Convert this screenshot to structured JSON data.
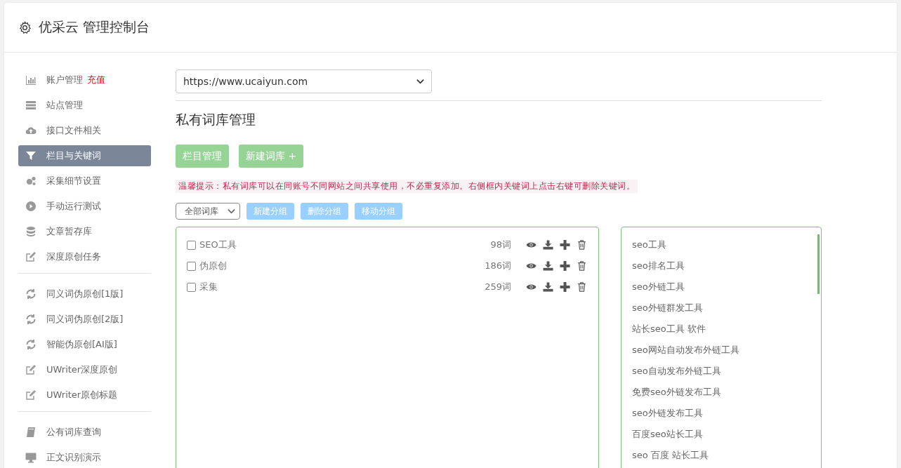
{
  "header": {
    "title": "优采云 管理控制台"
  },
  "sidebar": {
    "groups": [
      [
        {
          "label": "账户管理",
          "badge": "充值",
          "selected": false
        },
        {
          "label": "站点管理",
          "selected": false
        },
        {
          "label": "接口文件相关",
          "selected": false
        },
        {
          "label": "栏目与关键词",
          "selected": true
        },
        {
          "label": "采集细节设置",
          "selected": false
        },
        {
          "label": "手动运行测试",
          "selected": false
        },
        {
          "label": "文章暂存库",
          "selected": false
        },
        {
          "label": "深度原创任务",
          "selected": false
        }
      ],
      [
        {
          "label": "同义词伪原创[1版]",
          "selected": false
        },
        {
          "label": "同义词伪原创[2版]",
          "selected": false
        },
        {
          "label": "智能伪原创[AI版]",
          "selected": false
        },
        {
          "label": "UWriter深度原创",
          "selected": false
        },
        {
          "label": "UWriter原创标题",
          "selected": false
        }
      ],
      [
        {
          "label": "公有词库查询",
          "selected": false
        },
        {
          "label": "正文识别演示",
          "selected": false
        }
      ]
    ]
  },
  "site_select": {
    "value": "https://www.ucaiyun.com"
  },
  "heading": "私有词库管理",
  "actions": [
    "栏目管理",
    "新建词库 +"
  ],
  "tip": "温馨提示：私有词库可以在同账号不同网站之间共享使用，不必重复添加。右侧框内关键词上点击右键可删除关键词。",
  "filter_select": {
    "value": "全部词库"
  },
  "group_buttons": [
    "新建分组",
    "删除分组",
    "移动分组"
  ],
  "libraries": [
    {
      "name": "SEO工具",
      "count": "98词",
      "checked": false
    },
    {
      "name": "伪原创",
      "count": "186词",
      "checked": false
    },
    {
      "name": "采集",
      "count": "259词",
      "checked": false
    }
  ],
  "keywords": [
    "seo工具",
    "seo排名工具",
    "seo外链工具",
    "seo外链群发工具",
    "站长seo工具 软件",
    "seo网站自动发布外链工具",
    "seo自动发布外链工具",
    "免费seo外链发布工具",
    "seo外链发布工具",
    "百度seo站长工具",
    "seo 百度 站长工具"
  ]
}
